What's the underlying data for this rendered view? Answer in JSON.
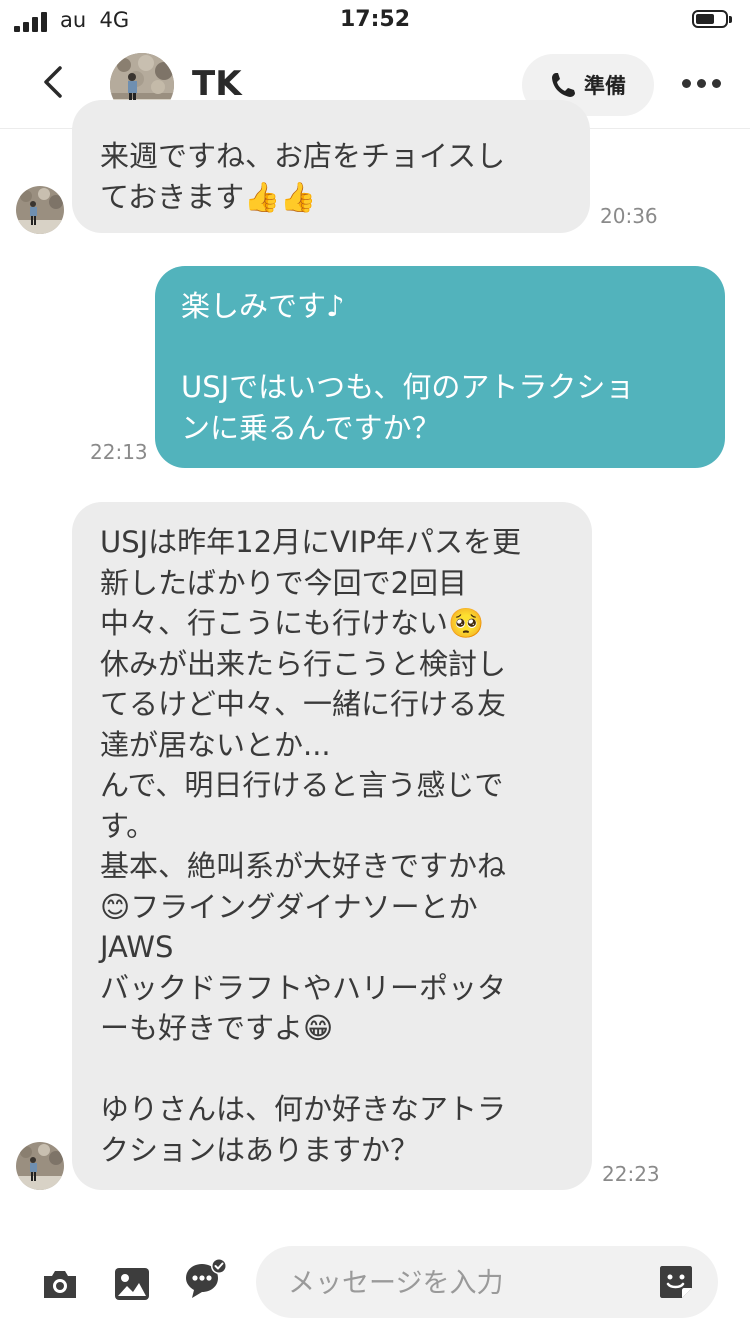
{
  "status_bar": {
    "carrier": "au",
    "network": "4G",
    "time": "17:52"
  },
  "header": {
    "contact_name": "TK",
    "call_label": "準備"
  },
  "messages": [
    {
      "sender": "TK",
      "text": "来週ですね、お店をチョイスし\nておきます👍👍",
      "time": "20:36"
    },
    {
      "sender": "me",
      "text": "楽しみです♪\n\nUSJではいつも、何のアトラクショ\nンに乗るんですか？",
      "time": "22:13"
    },
    {
      "sender": "TK",
      "text": "USJは昨年12月にVIP年パスを更\n新したばかりで今回で2回目\n中々、行こうにも行けない🥺\n休みが出来たら行こうと検討し\nてるけど中々、一緒に行ける友\n達が居ないとか...\nんで、明日行けると言う感じで\nす。\n基本、絶叫系が大好きですかね\n😊フライングダイナソーとか\nJAWS\nバックドラフトやハリーポッタ\nーも好きですよ😁\n\nゆりさんは、何か好きなアトラ\nクションはありますか？",
      "time": "22:23"
    }
  ],
  "input": {
    "placeholder": "メッセージを入力"
  },
  "icons": {
    "back": "chevron-left-icon",
    "call": "phone-icon",
    "more": "more-horizontal-icon",
    "camera": "camera-icon",
    "gallery": "image-icon",
    "chat_check": "chat-check-icon",
    "sticker": "sticker-icon"
  },
  "colors": {
    "outgoing_bubble": "#52b3bc",
    "incoming_bubble": "#ececec",
    "background": "#ffffff"
  }
}
